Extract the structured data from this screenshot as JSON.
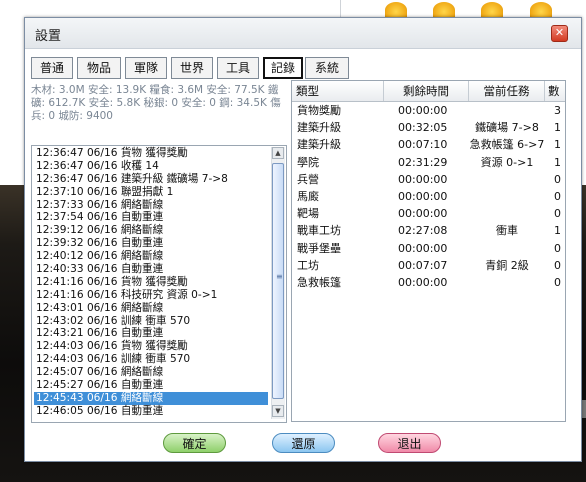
{
  "window": {
    "title": "設置",
    "close_label": "✕"
  },
  "tabs": [
    {
      "label": "普通"
    },
    {
      "label": "物品"
    },
    {
      "label": "軍隊"
    },
    {
      "label": "世界"
    },
    {
      "label": "工具"
    },
    {
      "label": "記錄",
      "active": true
    },
    {
      "label": "系統"
    }
  ],
  "resources_text": "木材: 3.0M 安全: 13.9K  糧食: 3.6M 安全: 77.5K 鐵礦: 612.7K 安全: 5.8K  秘銀: 0 安全: 0   鋼: 34.5K  傷兵: 0   城防: 9400",
  "log": [
    "12:36:47 06/16  貨物    獲得獎勵",
    "12:36:47 06/16  收穫    14",
    "12:36:47 06/16  建築升級   鐵礦場   7->8",
    "12:37:10 06/16  聯盟捐獻   1",
    "12:37:33 06/16  網絡斷線",
    "12:37:54 06/16  自動重連",
    "12:39:12 06/16  網絡斷線",
    "12:39:32 06/16  自動重連",
    "12:40:12 06/16  網絡斷線",
    "12:40:33 06/16  自動重連",
    "12:41:16 06/16  貨物    獲得獎勵",
    "12:41:16 06/16  科技研究   資源    0->1",
    "12:43:01 06/16  網絡斷線",
    "12:43:02 06/16  訓練    衝車    570",
    "12:43:21 06/16  自動重連",
    "12:44:03 06/16  貨物    獲得獎勵",
    "12:44:03 06/16  訓練    衝車    570",
    "12:45:07 06/16  網絡斷線",
    "12:45:27 06/16  自動重連",
    "12:45:43 06/16  網絡斷線",
    "12:46:05 06/16  自動重連"
  ],
  "selected_log_index": 19,
  "task_table": {
    "headers": [
      "類型",
      "剩餘時間",
      "當前任務",
      "數"
    ],
    "rows": [
      {
        "type": "貨物獎勵",
        "time": "00:00:00",
        "task": "",
        "count": "3"
      },
      {
        "type": "建築升級",
        "time": "00:32:05",
        "task": "鐵礦場 7->8",
        "count": "1"
      },
      {
        "type": "建築升級",
        "time": "00:07:10",
        "task": "急救帳篷 6->7",
        "count": "1"
      },
      {
        "type": "學院",
        "time": "02:31:29",
        "task": "資源 0->1",
        "count": "1"
      },
      {
        "type": "兵營",
        "time": "00:00:00",
        "task": "",
        "count": "0"
      },
      {
        "type": "馬廄",
        "time": "00:00:00",
        "task": "",
        "count": "0"
      },
      {
        "type": "靶場",
        "time": "00:00:00",
        "task": "",
        "count": "0"
      },
      {
        "type": "戰車工坊",
        "time": "02:27:08",
        "task": "衝車",
        "count": "1"
      },
      {
        "type": "戰爭堡壘",
        "time": "00:00:00",
        "task": "",
        "count": "0"
      },
      {
        "type": "工坊",
        "time": "00:07:07",
        "task": "青銅 2級",
        "count": "0"
      },
      {
        "type": "急救帳篷",
        "time": "00:00:00",
        "task": "",
        "count": "0"
      }
    ]
  },
  "buttons": {
    "ok": "確定",
    "reset": "還原",
    "exit": "退出"
  },
  "colors": {
    "selection": "#3f8fd8",
    "ok": "#8fd06b",
    "reset": "#8cc6f0",
    "exit": "#f08aa8"
  }
}
